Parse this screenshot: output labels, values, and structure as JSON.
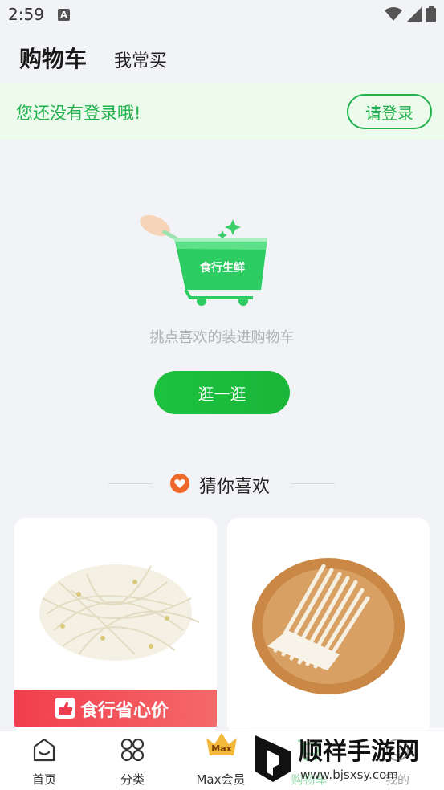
{
  "status_bar": {
    "time": "2:59",
    "notification_letter": "A"
  },
  "header": {
    "title": "购物车",
    "tab_frequent": "我常买"
  },
  "login_banner": {
    "message": "您还没有登录哦!",
    "button_label": "请登录"
  },
  "cart_logo_text": "食行生鲜",
  "empty_state": {
    "message": "挑点喜欢的装进购物车",
    "button_label": "逛一逛"
  },
  "recommend": {
    "title": "猜你喜欢"
  },
  "products": [
    {
      "name": "bean-sprouts",
      "banner": "食行省心价"
    },
    {
      "name": "enoki-mushroom"
    }
  ],
  "tabbar": {
    "items": [
      {
        "label": "首页",
        "icon": "home-icon"
      },
      {
        "label": "分类",
        "icon": "category-icon"
      },
      {
        "label": "Max会员",
        "icon": "crown-icon",
        "badge": "Max"
      },
      {
        "label": "购物车",
        "icon": "cart-icon",
        "active": true
      },
      {
        "label": "我的",
        "icon": "profile-icon"
      }
    ]
  },
  "watermark": {
    "text": "顺祥手游网",
    "url": "www.bjsxsy.com"
  },
  "colors": {
    "accent": "#22b14c",
    "banner_red": "#f13e4e",
    "background": "#f2f3f6"
  }
}
